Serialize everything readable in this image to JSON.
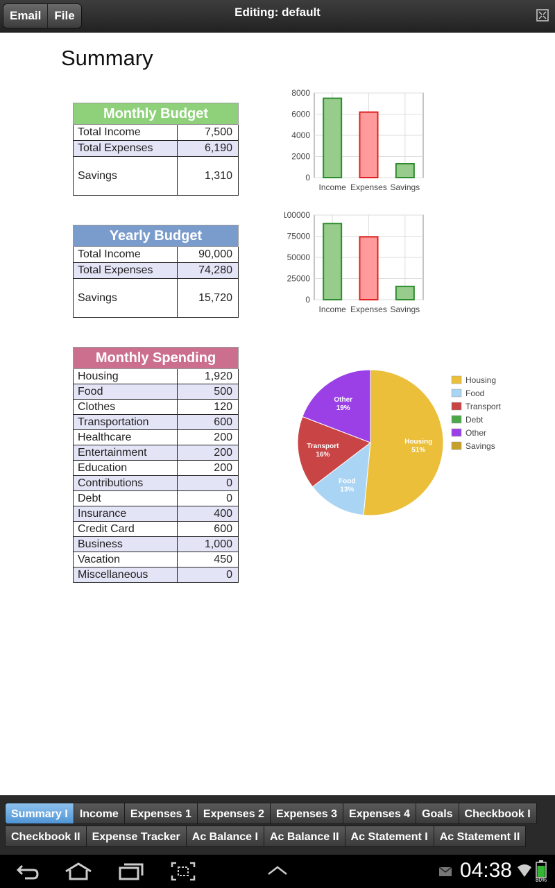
{
  "topbar": {
    "email": "Email",
    "file": "File",
    "title": "Editing: default"
  },
  "page_title": "Summary",
  "monthly": {
    "header": "Monthly Budget",
    "color": "#8fd17a",
    "rows": [
      {
        "label": "Total Income",
        "value": "7,500"
      },
      {
        "label": "Total Expenses",
        "value": "6,190"
      },
      {
        "label": "Savings",
        "value": "1,310"
      }
    ]
  },
  "yearly": {
    "header": "Yearly Budget",
    "color": "#7a9ccd",
    "rows": [
      {
        "label": "Total Income",
        "value": "90,000"
      },
      {
        "label": "Total Expenses",
        "value": "74,280"
      },
      {
        "label": "Savings",
        "value": "15,720"
      }
    ]
  },
  "spending": {
    "header": "Monthly Spending",
    "color": "#cc6f8f",
    "rows": [
      {
        "label": "Housing",
        "value": "1,920"
      },
      {
        "label": "Food",
        "value": "500"
      },
      {
        "label": "Clothes",
        "value": "120"
      },
      {
        "label": "Transportation",
        "value": "600"
      },
      {
        "label": "Healthcare",
        "value": "200"
      },
      {
        "label": "Entertainment",
        "value": "200"
      },
      {
        "label": "Education",
        "value": "200"
      },
      {
        "label": "Contributions",
        "value": "0"
      },
      {
        "label": "Debt",
        "value": "0"
      },
      {
        "label": "Insurance",
        "value": "400"
      },
      {
        "label": "Credit Card",
        "value": "600"
      },
      {
        "label": "Business",
        "value": "1,000"
      },
      {
        "label": "Vacation",
        "value": "450"
      },
      {
        "label": "Miscellaneous",
        "value": "0"
      }
    ]
  },
  "chart_data": [
    {
      "type": "bar",
      "categories": [
        "Income",
        "Expenses",
        "Savings"
      ],
      "values": [
        7500,
        6190,
        1310
      ],
      "ylim": [
        0,
        8000
      ],
      "yticks": [
        "0",
        "2000",
        "4000",
        "6000",
        "8000"
      ],
      "colors": [
        "#97cc8d",
        "#ff9b9b",
        "#97cc8d"
      ],
      "stroke_colors": [
        "#2e8b2e",
        "#e02020",
        "#2e8b2e"
      ]
    },
    {
      "type": "bar",
      "categories": [
        "Income",
        "Expenses",
        "Savings"
      ],
      "values": [
        90000,
        74280,
        15720
      ],
      "ylim": [
        0,
        100000
      ],
      "yticks": [
        "0",
        "25000",
        "50000",
        "75000",
        "100000"
      ],
      "colors": [
        "#97cc8d",
        "#ff9b9b",
        "#97cc8d"
      ],
      "stroke_colors": [
        "#2e8b2e",
        "#e02020",
        "#2e8b2e"
      ]
    },
    {
      "type": "pie",
      "slices": [
        {
          "name": "Housing",
          "pct": 51,
          "label": "Housing",
          "pct_label": "51%",
          "color": "#ebbf3a"
        },
        {
          "name": "Food",
          "pct": 13,
          "label": "Food",
          "pct_label": "13%",
          "color": "#aad4f4"
        },
        {
          "name": "Transport",
          "pct": 16,
          "label": "Transport",
          "pct_label": "16%",
          "color": "#c94444"
        },
        {
          "name": "Debt",
          "pct": 0,
          "label": "",
          "pct_label": "",
          "color": "#4aa84a"
        },
        {
          "name": "Other",
          "pct": 19,
          "label": "Other",
          "pct_label": "19%",
          "color": "#9a40e6"
        },
        {
          "name": "Savings",
          "pct": 0,
          "label": "",
          "pct_label": "",
          "color": "#c6a12a"
        }
      ],
      "legend": [
        "Housing",
        "Food",
        "Transport",
        "Debt",
        "Other",
        "Savings"
      ],
      "legend_placement": "right"
    }
  ],
  "tabs_row1": [
    "Summary I",
    "Income",
    "Expenses 1",
    "Expenses 2",
    "Expenses 3",
    "Expenses 4",
    "Goals",
    "Checkbook I"
  ],
  "tabs_row2": [
    "Checkbook II",
    "Expense Tracker",
    "Ac Balance I",
    "Ac Balance II",
    "Ac Statement I",
    "Ac Statement II"
  ],
  "active_tab": "Summary I",
  "status": {
    "time": "04:38",
    "battery": "80%"
  }
}
